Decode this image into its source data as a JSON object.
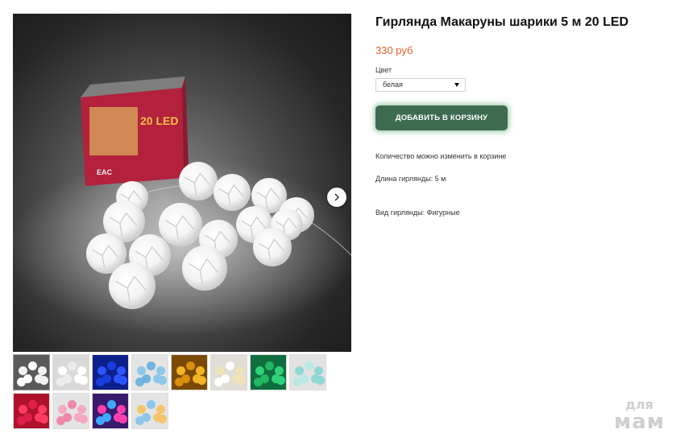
{
  "product": {
    "title": "Гирлянда Макаруны шарики 5 м 20 LED",
    "price": "330 руб",
    "color_label": "Цвет",
    "color_selected": "белая",
    "cart_button": "ДОБАВИТЬ В КОРЗИНУ",
    "qty_note": "Количество можно изменить в корзине",
    "length": "Длина гирлянды: 5 м",
    "kind": "Вид гирлянды: Фигурные"
  },
  "gallery": {
    "box_text": "20 LED",
    "box_small": "EAC",
    "next_icon": "chevron-right-icon",
    "thumbnails": [
      {
        "name": "thumb-white-lit",
        "bg": "#5a5a5a",
        "ball": "#f2f2f2",
        "alt": "#ffffff"
      },
      {
        "name": "thumb-white",
        "bg": "#d9d9d9",
        "ball": "#ffffff",
        "alt": "#ececec"
      },
      {
        "name": "thumb-blue-lit",
        "bg": "#0d1f8a",
        "ball": "#2d55ff",
        "alt": "#1a3de0"
      },
      {
        "name": "thumb-light-blue",
        "bg": "#e4e4e4",
        "ball": "#8fc7ea",
        "alt": "#6fb4e2"
      },
      {
        "name": "thumb-yellow-lit",
        "bg": "#7a4a05",
        "ball": "#f3b527",
        "alt": "#d98e0e"
      },
      {
        "name": "thumb-cream",
        "bg": "#e0ddd6",
        "ball": "#efe3b9",
        "alt": "#ffffff"
      },
      {
        "name": "thumb-green-lit",
        "bg": "#0f6e3d",
        "ball": "#2fd27a",
        "alt": "#22b864"
      },
      {
        "name": "thumb-mint",
        "bg": "#e2e2e2",
        "ball": "#8ed8d4",
        "alt": "#b7e8e4"
      },
      {
        "name": "thumb-red-lit",
        "bg": "#b0122d",
        "ball": "#ff3d63",
        "alt": "#e0204a"
      },
      {
        "name": "thumb-pink",
        "bg": "#e4e4e4",
        "ball": "#f4a9c1",
        "alt": "#ef87aa"
      },
      {
        "name": "thumb-multicolor-lit",
        "bg": "#3a1a6a",
        "ball": "#ff3fb0",
        "alt": "#3fa9ff"
      },
      {
        "name": "thumb-multicolor",
        "bg": "#e4e4e4",
        "ball": "#f5c46b",
        "alt": "#8ec6ea"
      }
    ]
  },
  "watermark": {
    "top": "для",
    "bottom": "мам"
  },
  "colors": {
    "price": "#e0612b",
    "cart_button": "#3d6b4f",
    "cart_glow": "#4fa464"
  }
}
